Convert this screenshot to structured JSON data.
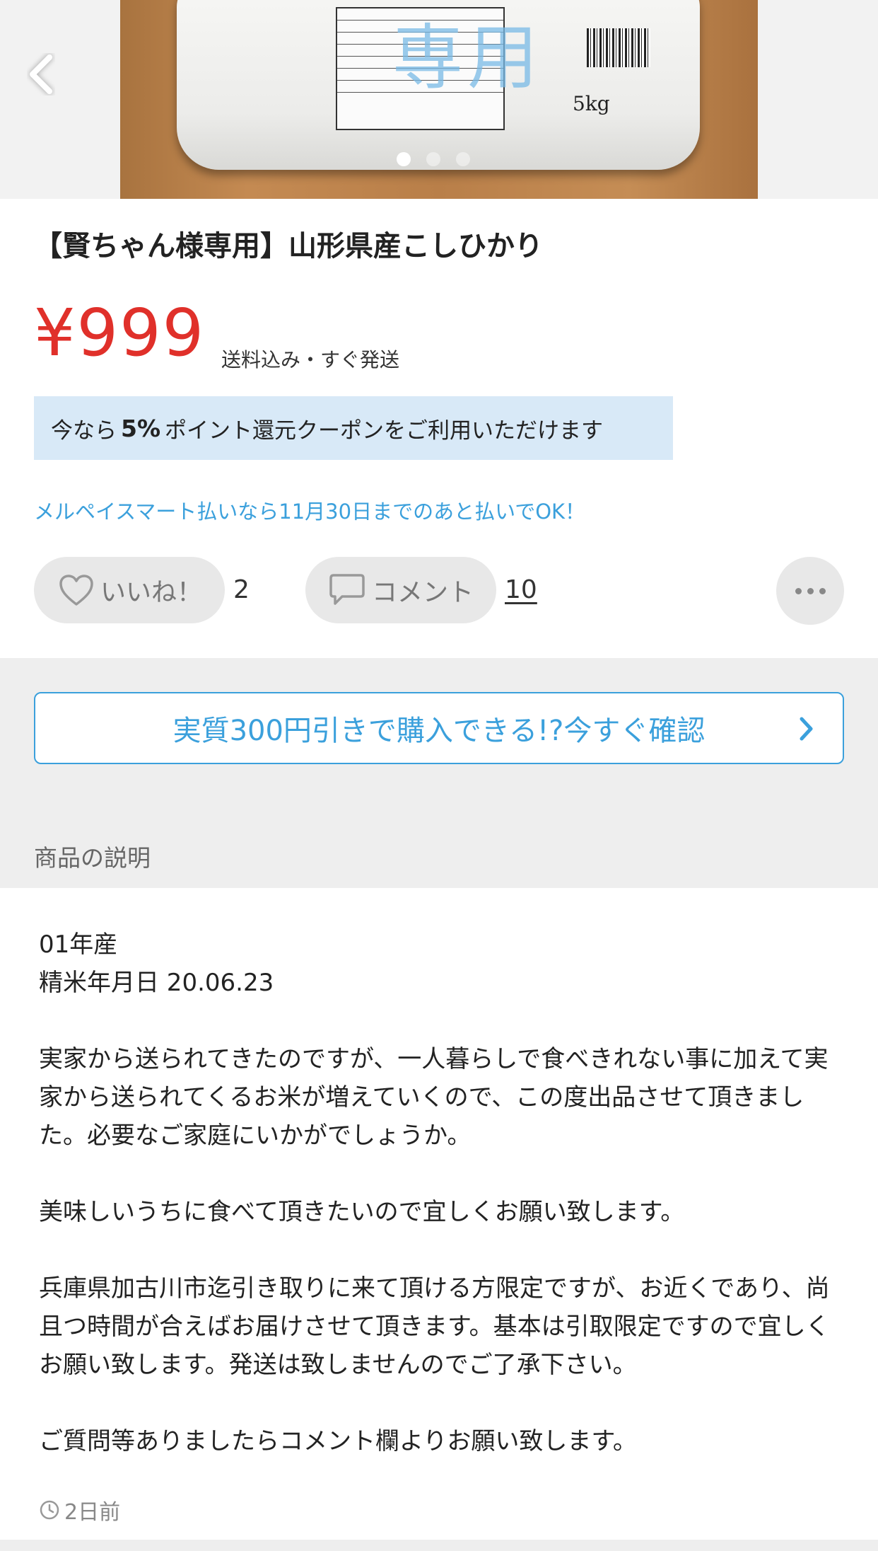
{
  "hero": {
    "overlay_text": "専用",
    "bag_weight": "5kg",
    "page_dots": 3,
    "active_dot": 0
  },
  "item": {
    "title": "【賢ちゃん様専用】山形県産こしひかり",
    "price": "¥999",
    "shipping": "送料込み・すぐ発送"
  },
  "coupon": {
    "prefix": "今なら",
    "rate": "5%",
    "suffix": "ポイント還元クーポンをご利用いただけます"
  },
  "merpay_notice": "メルペイスマート払いなら11月30日までのあと払いでOK！",
  "actions": {
    "like_label": "いいね！",
    "like_count": "2",
    "comment_label": "コメント",
    "comment_count": "10"
  },
  "promo_button": "実質300円引きで購入できる!?今すぐ確認",
  "section_label": "商品の説明",
  "description": {
    "line1": "01年産",
    "line2": "精米年月日 20.06.23",
    "para1": "実家から送られてきたのですが、一人暮らしで食べきれない事に加えて実家から送られてくるお米が増えていくので、この度出品させて頂きました。必要なご家庭にいかがでしょうか。",
    "para2": "美味しいうちに食べて頂きたいので宜しくお願い致します。",
    "para3": "兵庫県加古川市迄引き取りに来て頂ける方限定ですが、お近くであり、尚且つ時間が合えばお届けさせて頂きます。基本は引取限定ですので宜しくお願い致します。発送は致しませんのでご了承下さい。",
    "para4": "ご質問等ありましたらコメント欄よりお願い致します。"
  },
  "posted_time": "2日前",
  "colors": {
    "price": "#e0302a",
    "accent": "#3ba0dc",
    "coupon_bg": "#d8e9f7"
  }
}
